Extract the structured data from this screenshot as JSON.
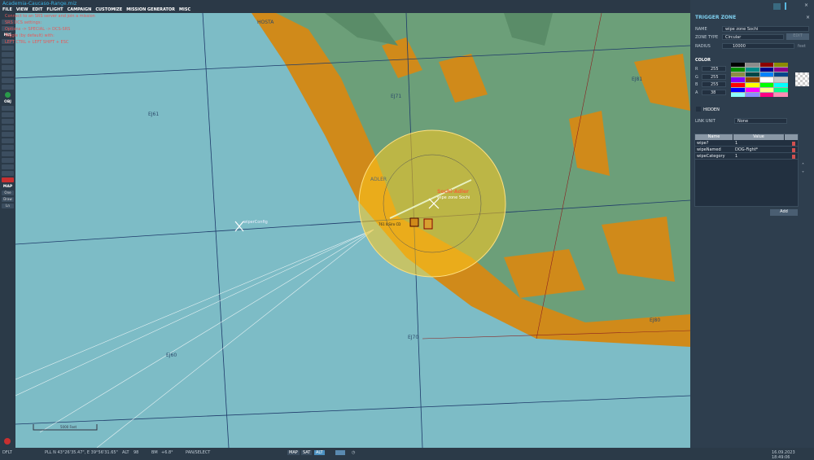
{
  "app": {
    "title": "Academia-Caucaso-Range.miz"
  },
  "menu": [
    "FILE",
    "VIEW",
    "EDIT",
    "FLIGHT",
    "CAMPAIGN",
    "CUSTOMIZE",
    "MISSION GENERATOR",
    "MISC"
  ],
  "notice": [
    "Connect to an SRS server and join a mission",
    "SRS DCS settings:",
    "Options -> SPECIAL -> DCS-SRS",
    "Toggle (by default) with:",
    "LEFT CTRL + LEFT SHIFT + ESC"
  ],
  "toolbar": {
    "mis": "MIS",
    "obj": "OBJ",
    "map": "MAP",
    "map_items": [
      "One",
      "Draw",
      "Ln"
    ]
  },
  "map": {
    "labels": {
      "hosta": "HOSTA",
      "ej61": "EJ61",
      "ej71": "EJ71",
      "ej81": "EJ81",
      "ej60": "EJ60",
      "ej70": "EJ70",
      "ej80": "EJ80",
      "adler": "ADLER",
      "airport": "Sochi-Adler",
      "zone": "wipe zone Sochi",
      "config": "wiperConfig",
      "ils": "761 ILS/ro CD",
      "scale": "5000 Feet"
    },
    "colors": {
      "sea": "#7dbcc6",
      "land": "#6c9f79",
      "orange": "#d08a1a",
      "zone": "#ffc81e"
    }
  },
  "panel": {
    "title": "TRIGGER ZONE",
    "name_label": "NAME",
    "name_value": "wipe zone Sochi",
    "zone_type_label": "ZONE TYPE",
    "zone_type_value": "Circular",
    "edit": "EDIT",
    "radius_label": "RADIUS",
    "radius_value": "10000",
    "radius_unit": "feet",
    "color_label": "COLOR",
    "rgba": [
      {
        "l": "R",
        "v": "255"
      },
      {
        "l": "G",
        "v": "255"
      },
      {
        "l": "B",
        "v": "255"
      },
      {
        "l": "A",
        "v": "38"
      }
    ],
    "palette": [
      "#000000",
      "#8c8c8c",
      "#8c0000",
      "#8c8c00",
      "#008c00",
      "#008c8c",
      "#00008c",
      "#8c008c",
      "#8c8c46",
      "#004646",
      "#0082ff",
      "#00468c",
      "#8200ff",
      "#8c4600",
      "#ffffff",
      "#c8c8c8",
      "#ff0000",
      "#ffff00",
      "#00ff00",
      "#00ffff",
      "#0000ff",
      "#ff00ff",
      "#ffff8c",
      "#00ff8c",
      "#8cffff",
      "#8c8cff",
      "#ff0082",
      "#ff8cb4"
    ],
    "hidden_label": "HIDDEN",
    "link_unit_label": "LINK UNIT",
    "link_unit_value": "None",
    "table": {
      "headers": [
        "Name",
        "Value"
      ],
      "rows": [
        {
          "name": "wipe?",
          "value": "1"
        },
        {
          "name": "wipeNamed",
          "value": "DOG-Fight*"
        },
        {
          "name": "wipeCategory",
          "value": "1"
        }
      ]
    },
    "add": "Add"
  },
  "status": {
    "mode": "DFLT",
    "pll": "PLL  N 43°26'35.47\", E 39°56'31.65\"",
    "alt_label": "ALT",
    "alt": "98",
    "bm_label": "BM",
    "bm": "+6.8°",
    "tool": "PAN/SELECT",
    "map": "MAP",
    "sat": "SAT",
    "alt_btn": "ALT",
    "datetime": "16.09.2023 18:49:06"
  }
}
